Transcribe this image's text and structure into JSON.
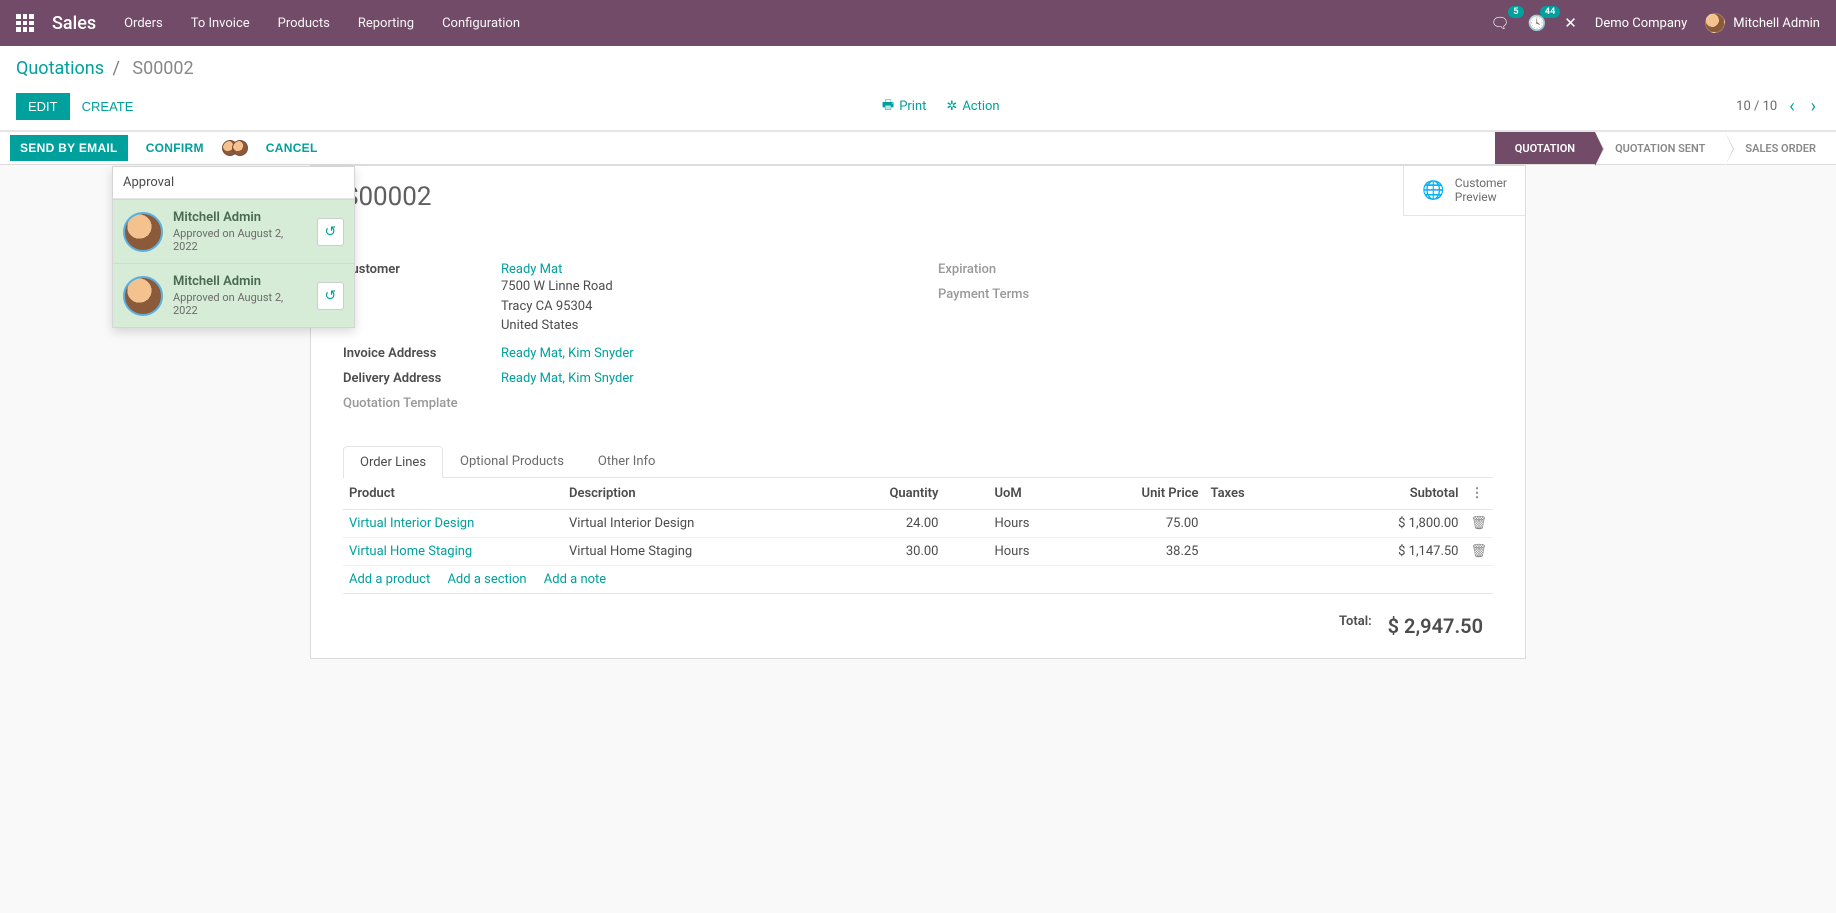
{
  "navbar": {
    "brand": "Sales",
    "menu": [
      "Orders",
      "To Invoice",
      "Products",
      "Reporting",
      "Configuration"
    ],
    "messages_badge": "5",
    "activities_badge": "44",
    "company": "Demo Company",
    "user": "Mitchell Admin"
  },
  "breadcrumb": {
    "parent": "Quotations",
    "current": "S00002"
  },
  "toolbar": {
    "edit": "EDIT",
    "create": "CREATE",
    "print": "Print",
    "action": "Action",
    "pager": "10 / 10"
  },
  "status": {
    "send_email": "SEND BY EMAIL",
    "confirm": "CONFIRM",
    "cancel": "CANCEL",
    "stages": [
      "QUOTATION",
      "QUOTATION SENT",
      "SALES ORDER"
    ],
    "active_stage_index": 0
  },
  "approval": {
    "title": "Approval",
    "items": [
      {
        "name": "Mitchell Admin",
        "meta": "Approved on August 2, 2022"
      },
      {
        "name": "Mitchell Admin",
        "meta": "Approved on August 2, 2022"
      }
    ]
  },
  "form": {
    "name": "S00002",
    "customer_preview": "Customer\nPreview",
    "labels": {
      "customer": "Customer",
      "invoice_address": "Invoice Address",
      "delivery_address": "Delivery Address",
      "quotation_template": "Quotation Template",
      "expiration": "Expiration",
      "payment_terms": "Payment Terms"
    },
    "customer": {
      "name": "Ready Mat",
      "street": "7500 W Linne Road",
      "city": "Tracy CA 95304",
      "country": "United States"
    },
    "invoice_address": "Ready Mat, Kim Snyder",
    "delivery_address": "Ready Mat, Kim Snyder"
  },
  "tabs": {
    "items": [
      "Order Lines",
      "Optional Products",
      "Other Info"
    ],
    "active": 0,
    "columns": {
      "product": "Product",
      "description": "Description",
      "quantity": "Quantity",
      "uom": "UoM",
      "unit_price": "Unit Price",
      "taxes": "Taxes",
      "subtotal": "Subtotal"
    },
    "lines": [
      {
        "product": "Virtual Interior Design",
        "description": "Virtual Interior Design",
        "qty": "24.00",
        "uom": "Hours",
        "price": "75.00",
        "taxes": "",
        "subtotal": "$ 1,800.00"
      },
      {
        "product": "Virtual Home Staging",
        "description": "Virtual Home Staging",
        "qty": "30.00",
        "uom": "Hours",
        "price": "38.25",
        "taxes": "",
        "subtotal": "$ 1,147.50"
      }
    ],
    "add_product": "Add a product",
    "add_section": "Add a section",
    "add_note": "Add a note",
    "total_label": "Total:",
    "total_value": "$ 2,947.50"
  }
}
